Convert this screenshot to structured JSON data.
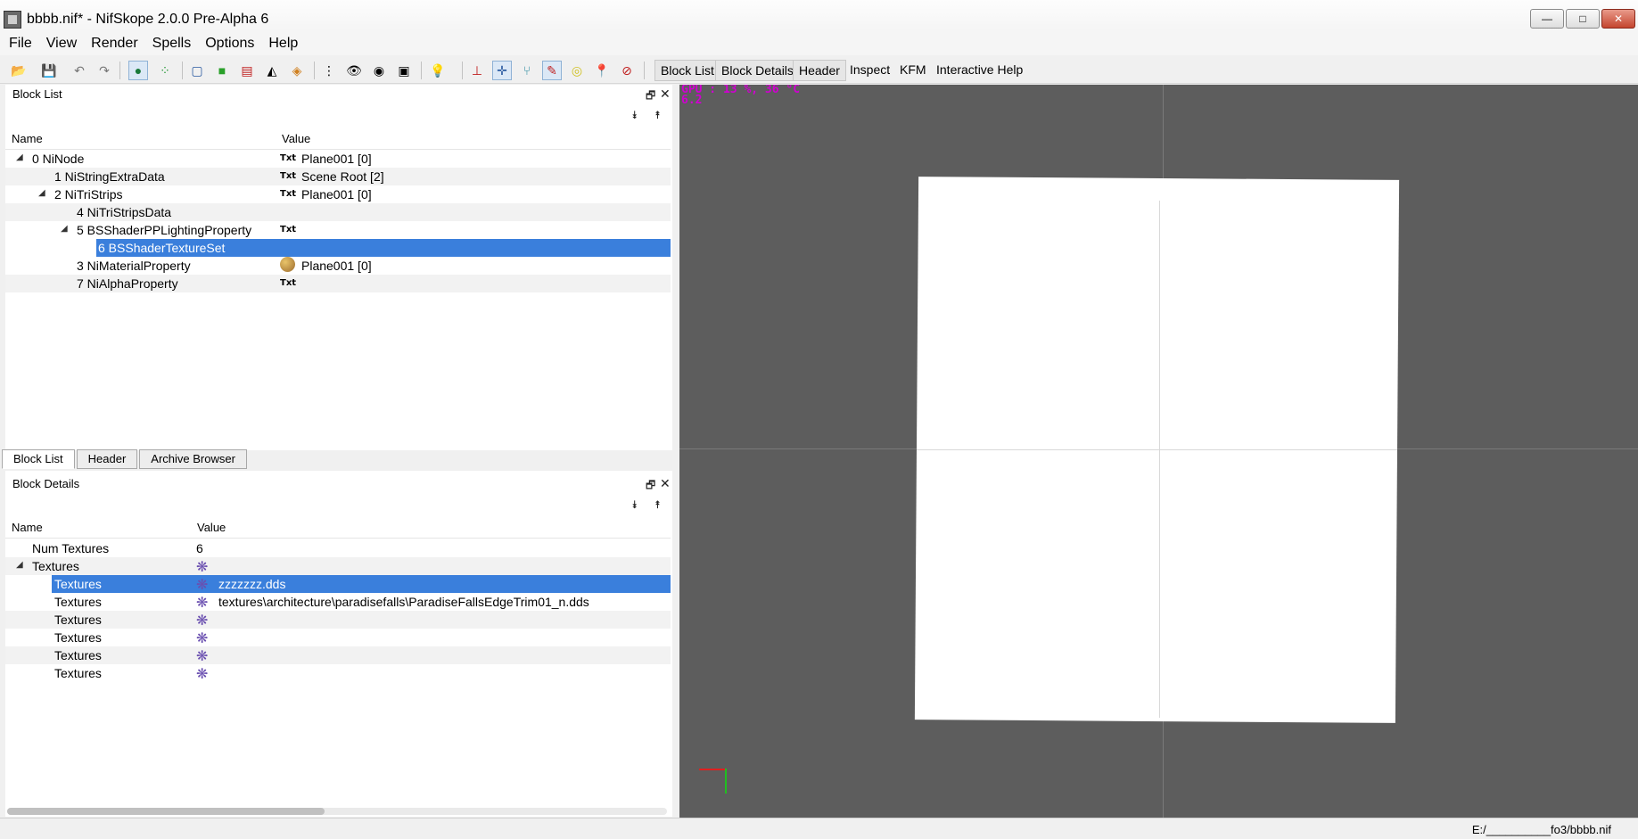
{
  "window": {
    "title": "bbbb.nif* - NifSkope 2.0.0 Pre-Alpha 6",
    "controls": {
      "minimize": "—",
      "maximize": "□",
      "close": "✕"
    }
  },
  "menu": [
    "File",
    "View",
    "Render",
    "Spells",
    "Options",
    "Help"
  ],
  "toolbar": {
    "tabs": [
      "Block List",
      "Block Details",
      "Header",
      "Inspect",
      "KFM",
      "Interactive Help"
    ]
  },
  "block_list": {
    "title": "Block List",
    "columns": {
      "name": "Name",
      "value": "Value"
    },
    "rows": [
      {
        "name": "0 NiNode",
        "value": "Plane001 [0]",
        "badge": "Txt"
      },
      {
        "name": "1 NiStringExtraData",
        "value": "Scene Root [2]",
        "badge": "Txt"
      },
      {
        "name": "2 NiTriStrips",
        "value": "Plane001 [0]",
        "badge": "Txt"
      },
      {
        "name": "4 NiTriStripsData",
        "value": "",
        "badge": ""
      },
      {
        "name": "5 BSShaderPPLightingProperty",
        "value": "",
        "badge": "Txt"
      },
      {
        "name": "6 BSShaderTextureSet",
        "value": "",
        "badge": ""
      },
      {
        "name": "3 NiMaterialProperty",
        "value": "Plane001 [0]",
        "badge": ""
      },
      {
        "name": "7 NiAlphaProperty",
        "value": "",
        "badge": "Txt"
      }
    ]
  },
  "bottom_tabs": [
    "Block List",
    "Header",
    "Archive Browser"
  ],
  "block_details": {
    "title": "Block Details",
    "columns": {
      "name": "Name",
      "value": "Value"
    },
    "rows": [
      {
        "name": "Num Textures",
        "value": "6"
      },
      {
        "name": "Textures",
        "value": ""
      },
      {
        "name": "Textures",
        "value": "zzzzzzz.dds"
      },
      {
        "name": "Textures",
        "value": "textures\\architecture\\paradisefalls\\ParadiseFallsEdgeTrim01_n.dds"
      },
      {
        "name": "Textures",
        "value": ""
      },
      {
        "name": "Textures",
        "value": ""
      },
      {
        "name": "Textures",
        "value": ""
      },
      {
        "name": "Textures",
        "value": ""
      }
    ]
  },
  "viewport": {
    "gpu_line1": "GPU : 13 %, 36 °C",
    "gpu_line2": "6.2"
  },
  "status": {
    "path": "E:/__________fo3/bbbb.nif"
  },
  "colors": {
    "selection": "#3a7fdc",
    "viewport_bg": "#5d5d5d",
    "gpu_text": "#d000d0"
  }
}
